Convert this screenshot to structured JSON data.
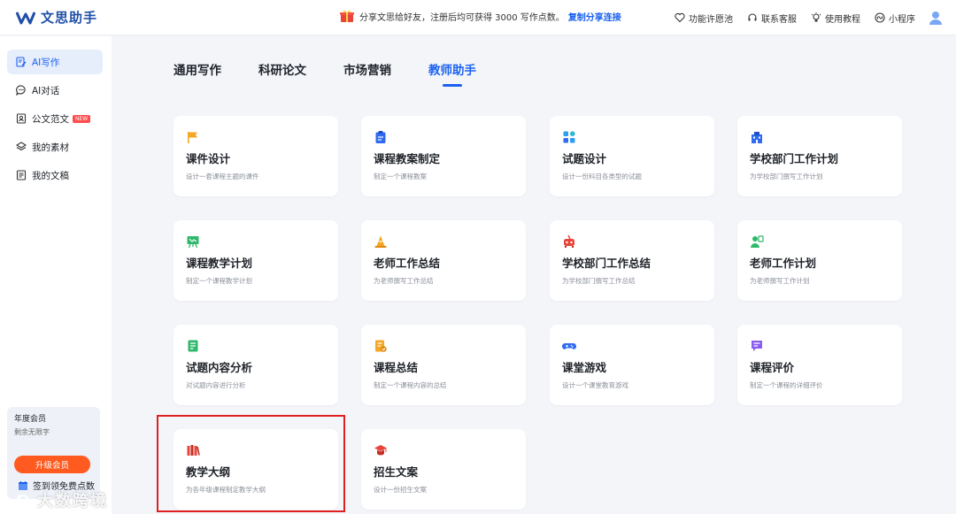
{
  "app": {
    "logo_text": "文思助手"
  },
  "banner": {
    "text": "分享文思给好友，注册后均可获得 3000 写作点数。",
    "link": "复制分享连接"
  },
  "top_actions": [
    {
      "label": "功能许愿池",
      "icon": "heart-icon"
    },
    {
      "label": "联系客服",
      "icon": "headset-icon"
    },
    {
      "label": "使用教程",
      "icon": "lightbulb-icon"
    },
    {
      "label": "小程序",
      "icon": "miniprogram-icon"
    }
  ],
  "sidebar": {
    "items": [
      {
        "label": "AI写作",
        "icon": "edit-icon",
        "active": true
      },
      {
        "label": "AI对话",
        "icon": "chat-icon"
      },
      {
        "label": "公文范文",
        "icon": "document-icon",
        "badge": "NEW"
      },
      {
        "label": "我的素材",
        "icon": "layers-icon"
      },
      {
        "label": "我的文稿",
        "icon": "file-icon"
      }
    ],
    "member": {
      "title": "年度会员",
      "subtitle": "剩余无限字",
      "upgrade_label": "升级会员"
    },
    "signin_label": "签到领免费点数"
  },
  "tabs": [
    {
      "label": "通用写作"
    },
    {
      "label": "科研论文"
    },
    {
      "label": "市场营销"
    },
    {
      "label": "教师助手",
      "active": true
    }
  ],
  "cards": [
    {
      "title": "课件设计",
      "desc": "设计一套课程主题的课件",
      "icon": "flag-icon",
      "color": "#f5a623"
    },
    {
      "title": "课程教案制定",
      "desc": "制定一个课程教案",
      "icon": "clipboard-icon",
      "color": "#2f6bf0"
    },
    {
      "title": "试题设计",
      "desc": "设计一份科目各类型的试题",
      "icon": "grid-icon",
      "color": "#2f9cf0"
    },
    {
      "title": "学校部门工作计划",
      "desc": "为学校部门撰写工作计划",
      "icon": "building-icon",
      "color": "#2f6bf0"
    },
    {
      "title": "课程教学计划",
      "desc": "制定一个课程教学计划",
      "icon": "easel-icon",
      "color": "#2fb86b"
    },
    {
      "title": "老师工作总结",
      "desc": "为老师撰写工作总结",
      "icon": "cone-icon",
      "color": "#f5a623"
    },
    {
      "title": "学校部门工作总结",
      "desc": "为学校部门撰写工作总结",
      "icon": "robot-icon",
      "color": "#e8443a"
    },
    {
      "title": "老师工作计划",
      "desc": "为老师撰写工作计划",
      "icon": "teacher-icon",
      "color": "#2fb86b"
    },
    {
      "title": "试题内容分析",
      "desc": "对试题内容进行分析",
      "icon": "book-icon",
      "color": "#2fb86b"
    },
    {
      "title": "课程总结",
      "desc": "制定一个课程内容的总结",
      "icon": "notes-icon",
      "color": "#f5a623"
    },
    {
      "title": "课堂游戏",
      "desc": "设计一个课堂教育游戏",
      "icon": "gamepad-icon",
      "color": "#2f6bf0"
    },
    {
      "title": "课程评价",
      "desc": "制定一个课程的详细评价",
      "icon": "comment-icon",
      "color": "#8a5cf0"
    },
    {
      "title": "教学大纲",
      "desc": "为各年级课程制定教学大纲",
      "icon": "books-icon",
      "color": "#e8443a"
    },
    {
      "title": "招生文案",
      "desc": "设计一份招生文案",
      "icon": "graduation-cap-icon",
      "color": "#e8443a"
    }
  ],
  "watermark": "大数跨境"
}
